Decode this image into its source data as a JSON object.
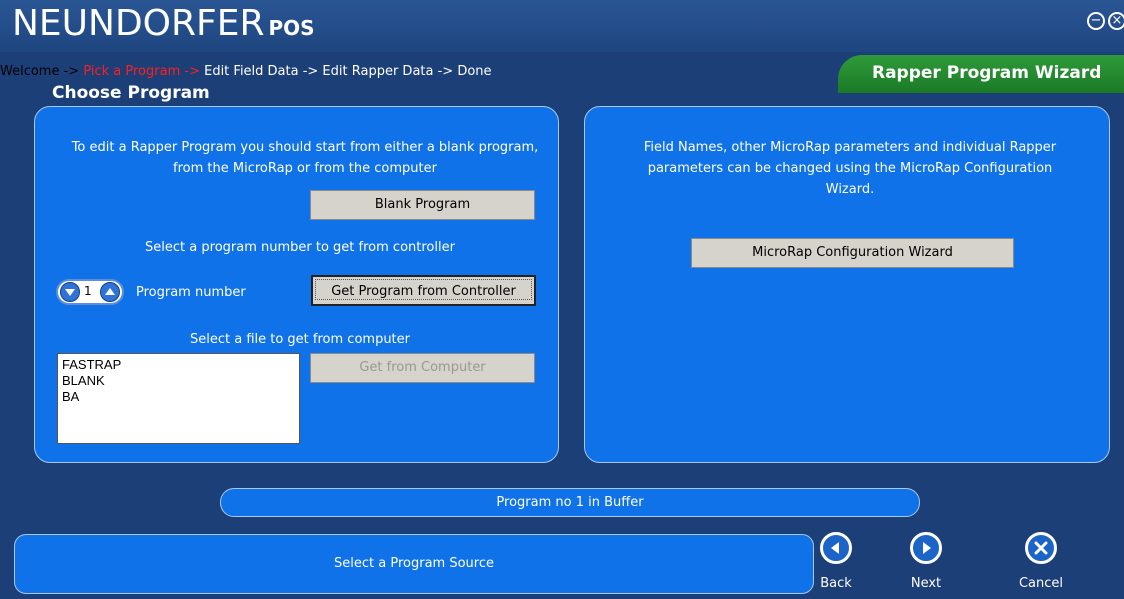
{
  "app": {
    "brand": "NEUNDORFER",
    "brand_suffix": "POS"
  },
  "breadcrumb": {
    "done": "Welcome ->",
    "current": " Pick a Program ->",
    "todo": " Edit Field Data -> Edit Rapper Data -> Done"
  },
  "wizard_title": "Rapper Program Wizard",
  "page_title": "Choose Program",
  "left_panel": {
    "intro": "To edit a Rapper Program you should start from either a blank program, from the MicroRap or from the computer",
    "blank_button": "Blank Program",
    "controller_prompt": "Select a program number to get from controller",
    "program_number_value": "1",
    "program_number_label": "Program number",
    "controller_button": "Get Program from Controller",
    "file_prompt": "Select a file to get from computer",
    "files": [
      "FASTRAP",
      "BLANK",
      "BA"
    ],
    "computer_button": "Get from Computer"
  },
  "right_panel": {
    "info": "Field Names, other MicroRap parameters and individual Rapper parameters can be changed using the MicroRap Configuration Wizard.",
    "config_button": "MicroRap Configuration Wizard"
  },
  "status": "Program no 1 in Buffer",
  "message": "Select a Program Source",
  "nav": {
    "back": "Back",
    "next": "Next",
    "cancel": "Cancel"
  },
  "colors": {
    "background": "#1c3f78",
    "panel": "#0f72e8",
    "wizard_tab": "#2f9a3a",
    "breadcrumb_current": "#ff1e1e"
  }
}
